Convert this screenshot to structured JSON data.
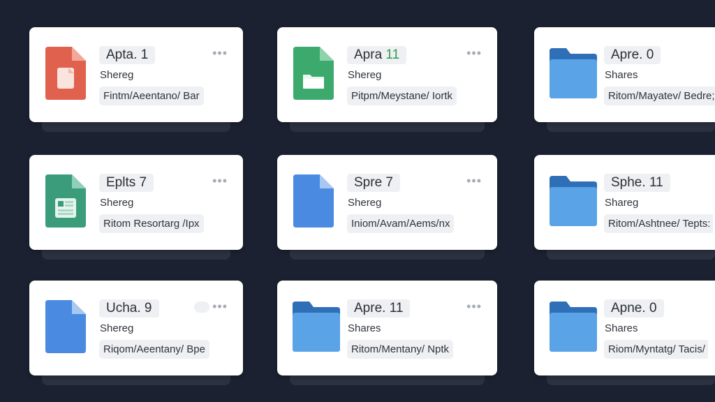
{
  "cards": [
    {
      "title": "Apta.",
      "num": "1",
      "num_color": "dark",
      "shared": "Shereg",
      "path": "Fintm/Aeentano/ Bar",
      "icon": "pdf-file-icon",
      "color": "#e0614d"
    },
    {
      "title": "Apra",
      "num": "11",
      "num_color": "green",
      "shared": "Shereg",
      "path": "Pitpm/Meystane/ Iortk",
      "icon": "folder-file-icon",
      "color": "#3daa6d"
    },
    {
      "title": "Apre.",
      "num": "0",
      "num_color": "dark",
      "shared": "Shares",
      "path": "Ritom/Mayatev/ Bedre;",
      "icon": "folder-icon",
      "color": "#4a90e2"
    },
    {
      "title": "Eplts",
      "num": "7",
      "num_color": "dark",
      "shared": "Shereg",
      "path": "Ritom Resortarg /Ipx",
      "icon": "spreadsheet-file-icon",
      "color": "#3b9c7c"
    },
    {
      "title": "Spre",
      "num": "7",
      "num_color": "dark",
      "shared": "Shereg",
      "path": "Iniom/Avam/Aems/nx",
      "icon": "doc-file-icon",
      "color": "#4a8ae0"
    },
    {
      "title": "Sphe.",
      "num": "11",
      "num_color": "dark",
      "shared": "Shareg",
      "path": "Ritom/Ashtnee/ Tepts:",
      "icon": "folder-icon",
      "color": "#4a90e2"
    },
    {
      "title": "Ucha.",
      "num": "9",
      "num_color": "dark",
      "shared": "Shereg",
      "path": "Riqom/Aeentany/ Bpe",
      "icon": "doc-file-icon",
      "color": "#4a8ae0"
    },
    {
      "title": "Apre.",
      "num": "11",
      "num_color": "dark",
      "shared": "Shares",
      "path": "Ritom/Mentany/ Nptk",
      "icon": "folder-icon",
      "color": "#4a90e2"
    },
    {
      "title": "Apne.",
      "num": "0",
      "num_color": "dark",
      "shared": "Shares",
      "path": "Riom/Myntatg/ Tacis/",
      "icon": "folder-icon",
      "color": "#4a90e2"
    }
  ],
  "more_label": "•••"
}
